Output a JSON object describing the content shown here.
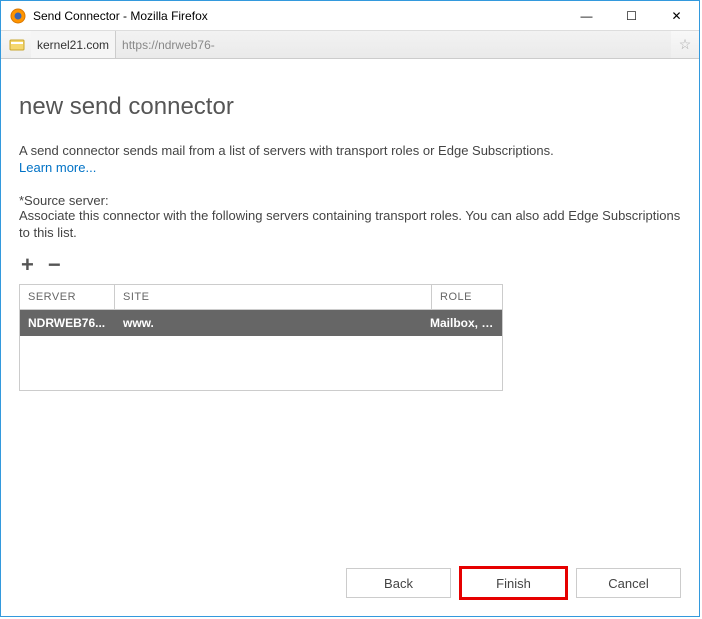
{
  "window": {
    "title": "Send Connector - Mozilla Firefox"
  },
  "addressbar": {
    "site": "kernel21.com",
    "url": "https://ndrweb76-"
  },
  "page": {
    "title": "new send connector",
    "description": "A send connector sends mail from a list of servers with transport roles or Edge Subscriptions.",
    "learn_more": "Learn more...",
    "source_label": "*Source server:",
    "source_desc": "Associate this connector with the following servers containing transport roles. You can also add Edge Subscriptions to this list."
  },
  "table": {
    "headers": {
      "server": "SERVER",
      "site": "SITE",
      "role": "ROLE"
    },
    "rows": [
      {
        "server": "NDRWEB76...",
        "site": "www.",
        "role": "Mailbox, Cl..."
      }
    ]
  },
  "buttons": {
    "back": "Back",
    "finish": "Finish",
    "cancel": "Cancel"
  },
  "icons": {
    "plus": "+",
    "minus": "−",
    "minimize": "—",
    "maximize": "☐",
    "close": "✕",
    "star": "☆"
  }
}
